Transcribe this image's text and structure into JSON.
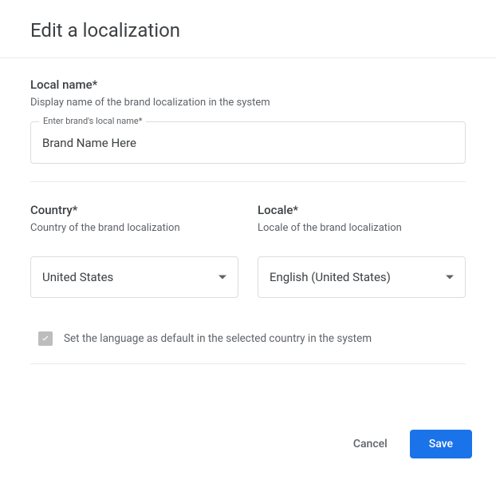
{
  "dialog": {
    "title": "Edit a localization"
  },
  "localName": {
    "label": "Local name*",
    "desc": "Display name of the brand localization in the system",
    "floating": "Enter brand's local name*",
    "value": "Brand Name Here"
  },
  "country": {
    "label": "Country*",
    "desc": "Country of the brand localization",
    "value": "United States"
  },
  "locale": {
    "label": "Locale*",
    "desc": "Locale of the brand localization",
    "value": "English (United States)"
  },
  "defaultCheckbox": {
    "checked": true,
    "label": "Set the language as default in the selected country in the system"
  },
  "actions": {
    "cancel": "Cancel",
    "save": "Save"
  }
}
